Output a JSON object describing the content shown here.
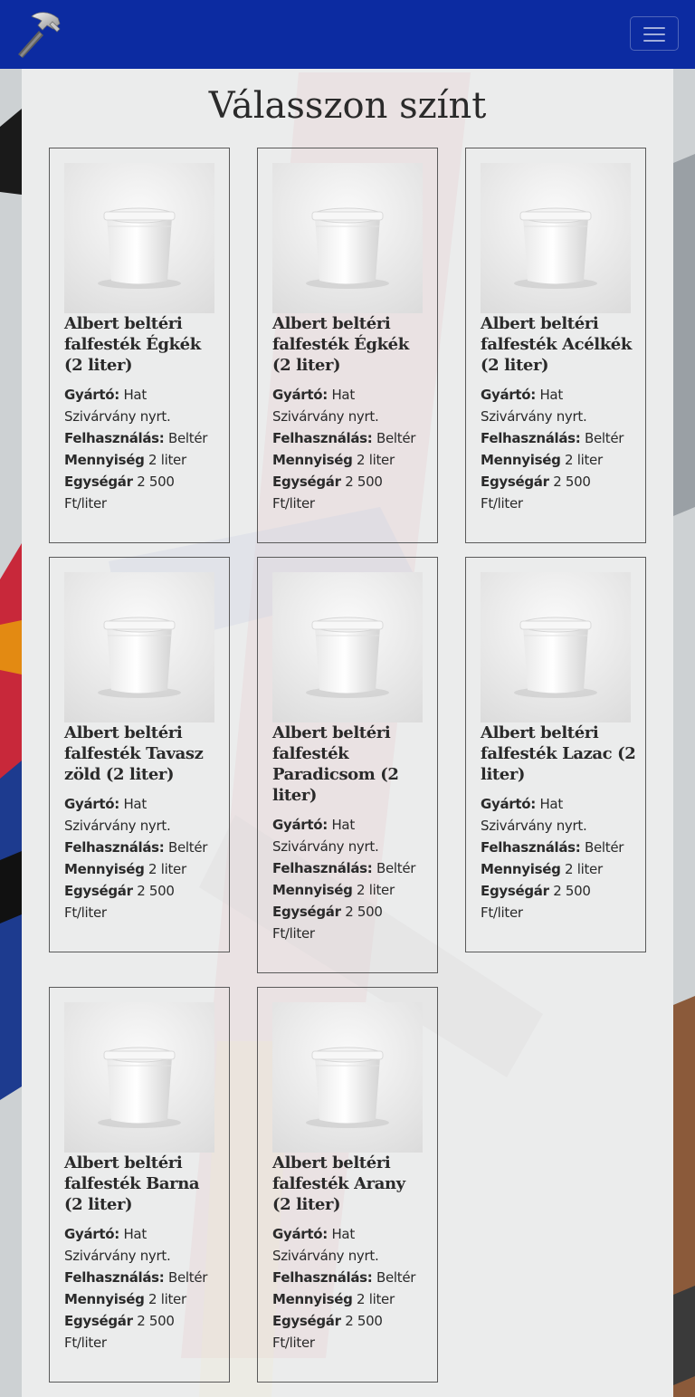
{
  "navbar": {
    "logo_icon": "hammer-icon",
    "menu_icon": "hamburger-menu-icon",
    "brand_color": "#0c2ba1"
  },
  "page": {
    "title": "Válasszon színt"
  },
  "labels": {
    "manufacturer": "Gyártó:",
    "usage": "Felhasználás:",
    "quantity": "Mennyiség",
    "unit_price": "Egységár"
  },
  "products": [
    {
      "name": "Albert beltéri falfesték Égkék (2 liter)",
      "manufacturer": "Hat Szivárvány nyrt.",
      "usage": "Beltér",
      "quantity": "2 liter",
      "unit_price": "2 500 Ft/liter",
      "image_icon": "white-paint-bucket-icon"
    },
    {
      "name": "Albert beltéri falfesték Égkék (2 liter)",
      "manufacturer": "Hat Szivárvány nyrt.",
      "usage": "Beltér",
      "quantity": "2 liter",
      "unit_price": "2 500 Ft/liter",
      "image_icon": "white-paint-bucket-icon"
    },
    {
      "name": "Albert beltéri falfesték Acélkék (2 liter)",
      "manufacturer": "Hat Szivárvány nyrt.",
      "usage": "Beltér",
      "quantity": "2 liter",
      "unit_price": "2 500 Ft/liter",
      "image_icon": "white-paint-bucket-icon"
    },
    {
      "name": "Albert beltéri falfesték Tavasz zöld (2 liter)",
      "manufacturer": "Hat Szivárvány nyrt.",
      "usage": "Beltér",
      "quantity": "2 liter",
      "unit_price": "2 500 Ft/liter",
      "image_icon": "white-paint-bucket-icon"
    },
    {
      "name": "Albert beltéri falfesték Paradicsom (2 liter)",
      "manufacturer": "Hat Szivárvány nyrt.",
      "usage": "Beltér",
      "quantity": "2 liter",
      "unit_price": "2 500 Ft/liter",
      "image_icon": "white-paint-bucket-icon"
    },
    {
      "name": "Albert beltéri falfesték Lazac (2 liter)",
      "manufacturer": "Hat Szivárvány nyrt.",
      "usage": "Beltér",
      "quantity": "2 liter",
      "unit_price": "2 500 Ft/liter",
      "image_icon": "white-paint-bucket-icon"
    },
    {
      "name": "Albert beltéri falfesték Barna (2 liter)",
      "manufacturer": "Hat Szivárvány nyrt.",
      "usage": "Beltér",
      "quantity": "2 liter",
      "unit_price": "2 500 Ft/liter",
      "image_icon": "white-paint-bucket-icon"
    },
    {
      "name": "Albert beltéri falfesték Arany (2 liter)",
      "manufacturer": "Hat Szivárvány nyrt.",
      "usage": "Beltér",
      "quantity": "2 liter",
      "unit_price": "2 500 Ft/liter",
      "image_icon": "white-paint-bucket-icon"
    }
  ]
}
